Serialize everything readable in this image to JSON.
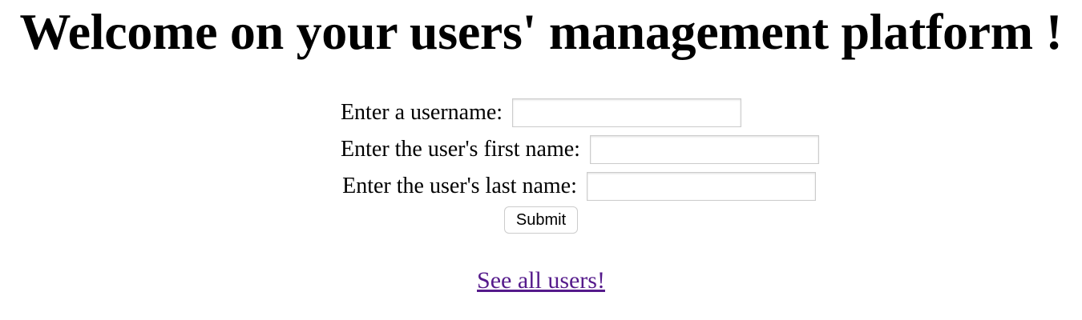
{
  "title": "Welcome on your users' management platform !",
  "form": {
    "username_label": "Enter a username:",
    "username_value": "",
    "first_name_label": "Enter the user's first name:",
    "first_name_value": "",
    "last_name_label": "Enter the user's last name:",
    "last_name_value": "",
    "submit_label": "Submit"
  },
  "link": "See all users!"
}
